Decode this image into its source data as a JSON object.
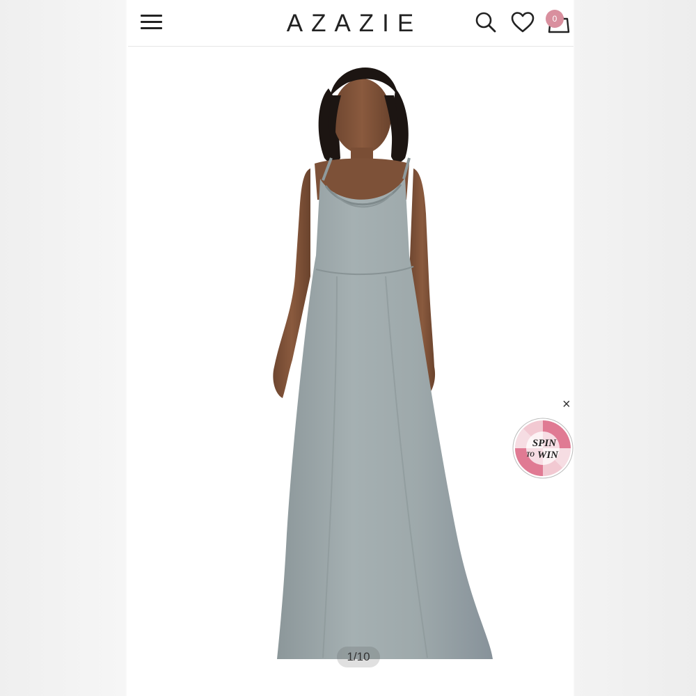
{
  "header": {
    "brand": "AZAZIE",
    "menu_icon": "hamburger-menu-icon",
    "search_icon": "search-icon",
    "wishlist_icon": "heart-icon",
    "cart_icon": "shopping-bag-icon",
    "cart_count": "0",
    "badge_color": "#d98f9e"
  },
  "gallery": {
    "image_description_icon": "dress-photo",
    "counter": "1/10",
    "dress_color": "#9aa5a7"
  },
  "promo": {
    "spin_line1": "SPIN",
    "spin_line2": "TO",
    "spin_line3": "WIN",
    "close_glyph": "×"
  }
}
